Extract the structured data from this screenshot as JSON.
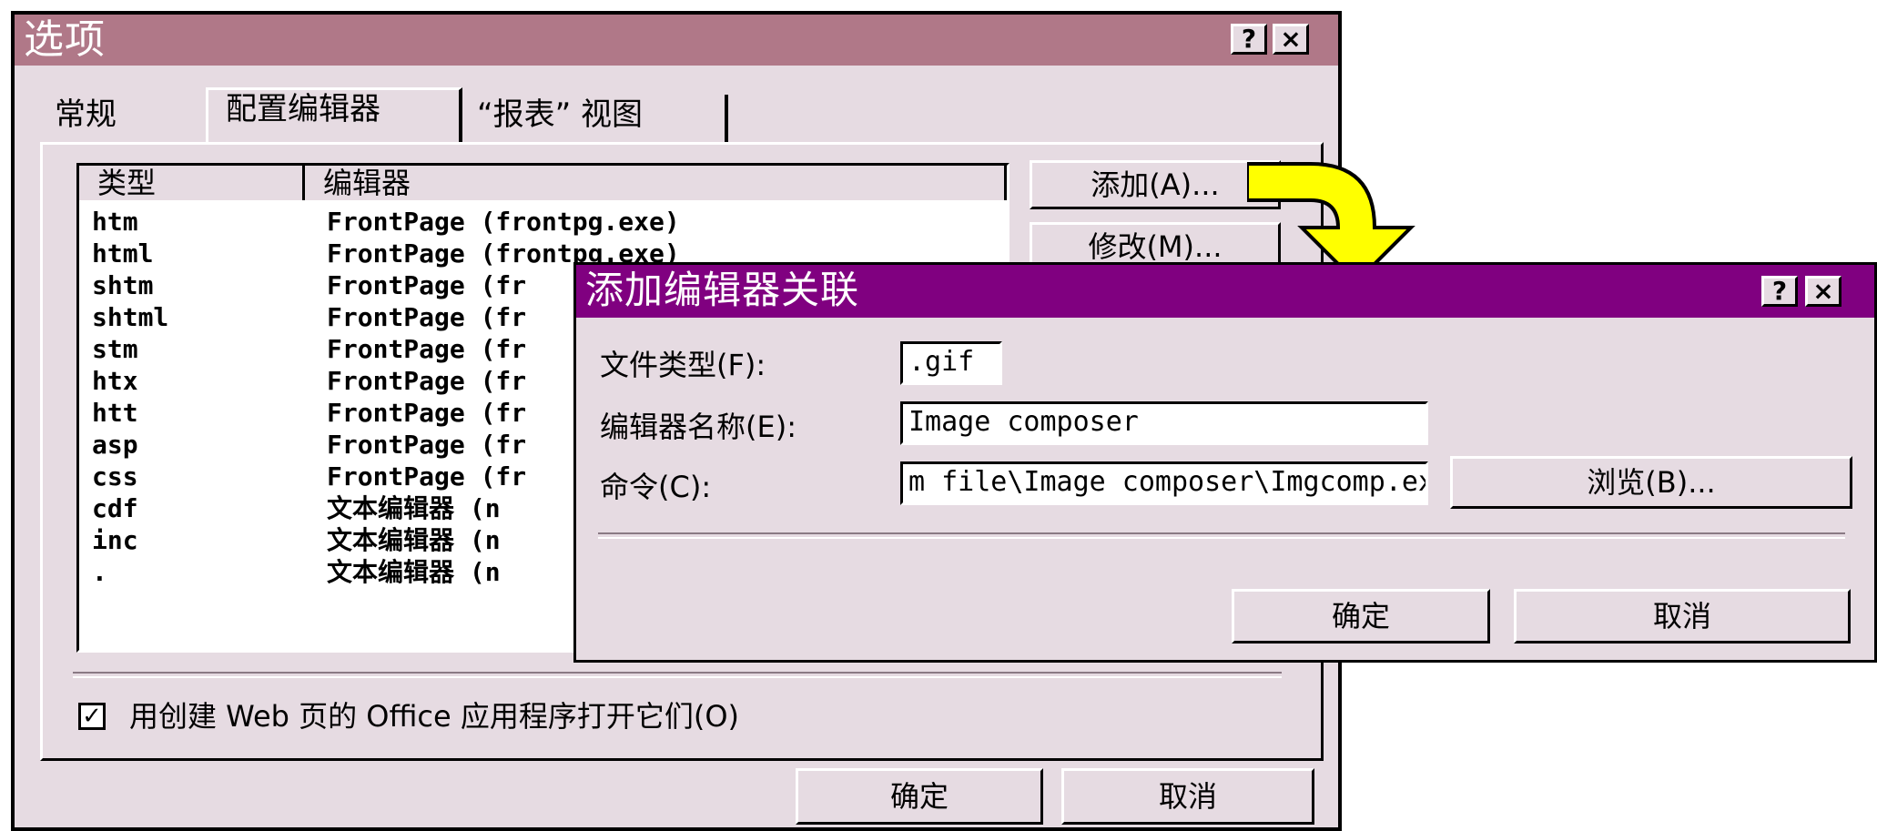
{
  "options_dialog": {
    "title": "选项",
    "help_label": "?",
    "close_label": "×",
    "tabs": [
      {
        "label": "常规"
      },
      {
        "label": "配置编辑器"
      },
      {
        "label": "“报表” 视图"
      }
    ],
    "list": {
      "columns": [
        "类型",
        "编辑器"
      ],
      "rows": [
        {
          "type": "htm",
          "editor": "FrontPage (frontpg.exe)"
        },
        {
          "type": "html",
          "editor": "FrontPage (frontpg.exe)"
        },
        {
          "type": "shtm",
          "editor": "FrontPage (fr"
        },
        {
          "type": "shtml",
          "editor": "FrontPage (fr"
        },
        {
          "type": "stm",
          "editor": "FrontPage (fr"
        },
        {
          "type": "htx",
          "editor": "FrontPage (fr"
        },
        {
          "type": "htt",
          "editor": "FrontPage (fr"
        },
        {
          "type": "asp",
          "editor": "FrontPage (fr"
        },
        {
          "type": "css",
          "editor": "FrontPage (fr"
        },
        {
          "type": "cdf",
          "editor": "文本编辑器 (n"
        },
        {
          "type": "inc",
          "editor": "文本编辑器 (n"
        },
        {
          "type": ".",
          "editor": "文本编辑器 (n"
        }
      ]
    },
    "add_button": "添加(A)...",
    "modify_button": "修改(M)...",
    "checkbox_checked": true,
    "checkbox_label": "用创建 Web 页的 Office 应用程序打开它们(O)",
    "ok_button": "确定",
    "cancel_button": "取消"
  },
  "assoc_dialog": {
    "title": "添加编辑器关联",
    "help_label": "?",
    "close_label": "×",
    "file_type_label": "文件类型(F):",
    "file_type_value": ".gif",
    "editor_name_label": "编辑器名称(E):",
    "editor_name_value": "Image composer",
    "command_label": "命令(C):",
    "command_value": "m file\\Image composer\\Imgcomp.exe",
    "browse_button": "浏览(B)...",
    "ok_button": "确定",
    "cancel_button": "取消"
  },
  "colors": {
    "dialog_face": "#e6dbe2",
    "options_titlebar": "#b07888",
    "assoc_titlebar": "#800080",
    "arrow_fill": "#ffff00"
  }
}
